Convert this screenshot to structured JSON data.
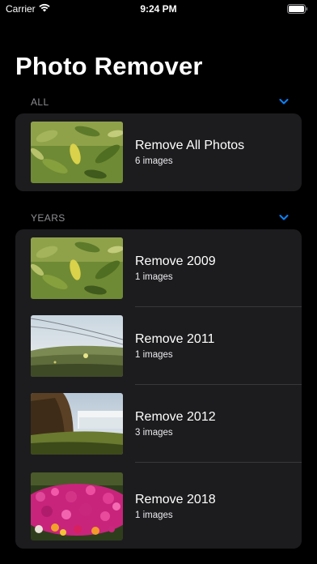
{
  "status_bar": {
    "carrier": "Carrier",
    "time": "9:24 PM"
  },
  "title": "Photo Remover",
  "colors": {
    "accent": "#0a84ff",
    "cell_bg": "#1c1c1e",
    "background": "#000000"
  },
  "sections": [
    {
      "header": "ALL",
      "rows": [
        {
          "title": "Remove All Photos",
          "subtitle": "6 images",
          "thumbnail": "leaves-photo"
        }
      ]
    },
    {
      "header": "YEARS",
      "rows": [
        {
          "title": "Remove 2009",
          "subtitle": "1 images",
          "thumbnail": "leaves-photo"
        },
        {
          "title": "Remove 2011",
          "subtitle": "1 images",
          "thumbnail": "meadow-photo"
        },
        {
          "title": "Remove 2012",
          "subtitle": "3 images",
          "thumbnail": "waterfall-photo"
        },
        {
          "title": "Remove 2018",
          "subtitle": "1 images",
          "thumbnail": "flowers-photo"
        }
      ]
    }
  ]
}
